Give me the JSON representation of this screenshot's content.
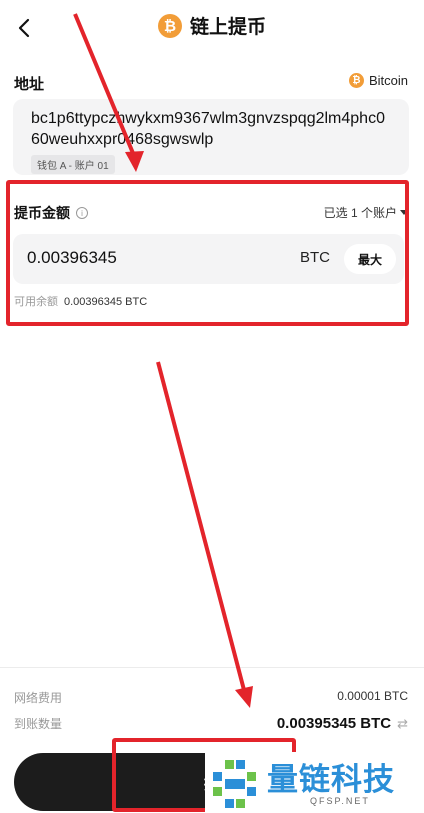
{
  "header": {
    "title": "链上提币",
    "coin_symbol": "₿"
  },
  "address": {
    "label": "地址",
    "network": "Bitcoin",
    "value": "bc1p6ttypczhwykxm9367wlm3gnvzspqg2lm4phc060weuhxxpr0468sgwswlp",
    "wallet_tag": "钱包 A - 账户 01"
  },
  "amount": {
    "label": "提币金额",
    "account_select": "已选 1 个账户",
    "value": "0.00396345",
    "unit": "BTC",
    "max_label": "最大",
    "available_label": "可用余额",
    "available_value": "0.00396345 BTC"
  },
  "summary": {
    "fee_label": "网络费用",
    "fee_value": "0.00001 BTC",
    "receive_label": "到账数量",
    "receive_value": "0.00395345 BTC"
  },
  "submit_label": "提",
  "watermark": {
    "text": "量链科技",
    "sub": "QFSP.NET"
  },
  "colors": {
    "accent_red": "#e3242b",
    "btc_orange": "#f29d38",
    "watermark_blue": "#2b8fd8"
  }
}
